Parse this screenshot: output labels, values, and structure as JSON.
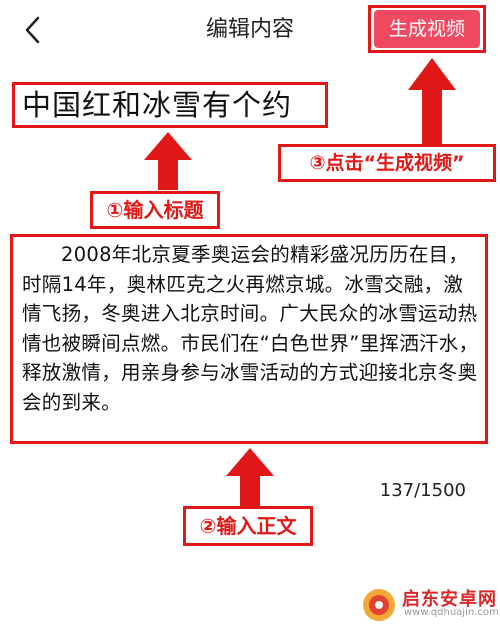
{
  "header": {
    "title": "编辑内容",
    "generate_button_label": "生成视频"
  },
  "editor": {
    "title_value": "中国红和冰雪有个约",
    "body_value": "2008年北京夏季奥运会的精彩盛况历历在目，时隔14年，奥林匹克之火再燃京城。冰雪交融，激情飞扬，冬奥进入北京时间。广大民众的冰雪运动热情也被瞬间点燃。市民们在“白色世界”里挥洒汗水，释放激情，用亲身参与冰雪活动的方式迎接北京冬奥会的到来。",
    "char_count": "137/1500"
  },
  "annotations": {
    "step1": "①输入标题",
    "step2": "②输入正文",
    "step3": "③点击“生成视频”"
  },
  "watermark": {
    "text": "启东安卓网",
    "sub": "www.qdhuajin.com"
  },
  "colors": {
    "annotation_red": "#e01818",
    "button_pink": "#ef4a62"
  },
  "icons": {
    "back": "chevron-left-icon",
    "arrow": "arrow-up-icon"
  }
}
